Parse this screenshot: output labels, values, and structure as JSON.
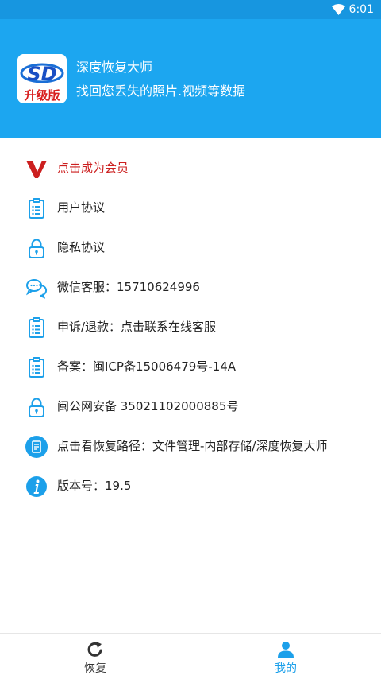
{
  "status_bar": {
    "time": "6:01"
  },
  "header": {
    "app_name": "深度恢复大师",
    "subtitle": "找回您丢失的照片.视频等数据",
    "logo": {
      "letters": "SD",
      "badge": "升级版"
    }
  },
  "menu": {
    "items": [
      {
        "label": "点击成为会员",
        "icon": "vip-v-icon"
      },
      {
        "label": "用户协议",
        "icon": "clipboard-icon"
      },
      {
        "label": "隐私协议",
        "icon": "lock-icon"
      },
      {
        "label": "微信客服：15710624996",
        "icon": "chat-bubbles-icon"
      },
      {
        "label": "申诉/退款：点击联系在线客服",
        "icon": "clipboard-icon"
      },
      {
        "label": "备案：闽ICP备15006479号-14A",
        "icon": "clipboard-icon"
      },
      {
        "label": "闽公网安备 35021102000885号",
        "icon": "lock-icon"
      },
      {
        "label": "点击看恢复路径：文件管理-内部存储/深度恢复大师",
        "icon": "document-icon"
      },
      {
        "label": "版本号：19.5",
        "icon": "info-icon"
      }
    ]
  },
  "bottom_nav": {
    "tabs": [
      {
        "label": "恢复",
        "icon": "refresh-icon",
        "active": false
      },
      {
        "label": "我的",
        "icon": "person-icon",
        "active": true
      }
    ]
  },
  "colors": {
    "header_bg": "#1ca6f0",
    "status_bar_bg": "#1796e0",
    "icon_blue": "#1ca0ea",
    "vip_red": "#cc1f1f",
    "active_tab": "#1ca0ea",
    "inactive_tab": "#333333"
  }
}
